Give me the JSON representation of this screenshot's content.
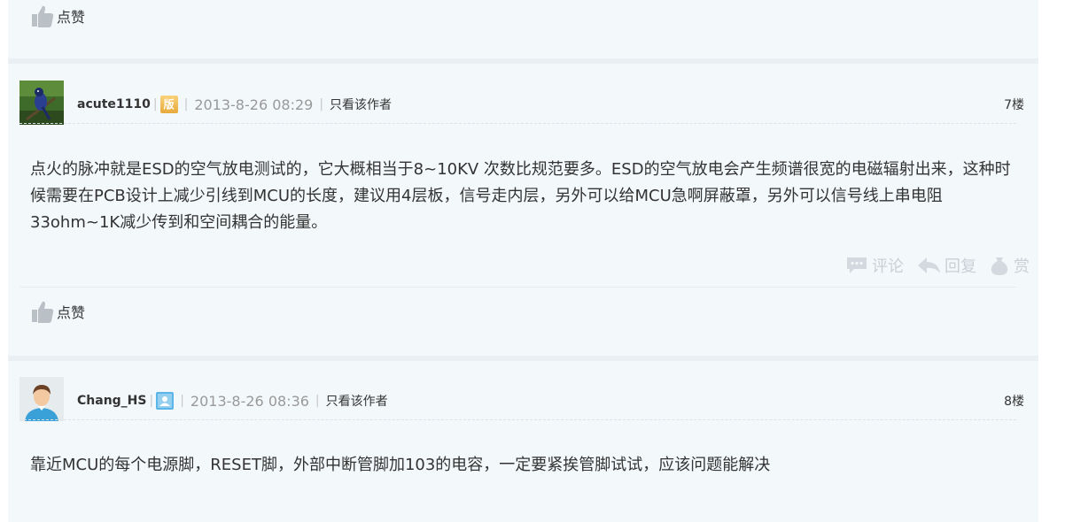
{
  "posts": [
    {
      "like_label": "点赞"
    },
    {
      "username": "acute1110",
      "badge": "版",
      "date": "2013-8-26 08:29",
      "only_author": "只看该作者",
      "floor": "7楼",
      "content": "点火的脉冲就是ESD的空气放电测试的，它大概相当于8~10KV 次数比规范要多。ESD的空气放电会产生频谱很宽的电磁辐射出来，这种时候需要在PCB设计上减少引线到MCU的长度，建议用4层板，信号走内层，另外可以给MCU急啊屏蔽罩，另外可以信号线上串电阻33ohm~1K减少传到和空间耦合的能量。",
      "actions": {
        "comment": "评论",
        "reply": "回复",
        "reward": "赏"
      },
      "like_label": "点赞"
    },
    {
      "username": "Chang_HS",
      "date": "2013-8-26 08:36",
      "only_author": "只看该作者",
      "floor": "8楼",
      "content": "靠近MCU的每个电源脚，RESET脚，外部中断管脚加103的电容，一定要紧挨管脚试试，应该问题能解决"
    }
  ],
  "colors": {
    "panel_bg": "#f3f8fb",
    "muted": "#999999",
    "icon_gray": "#c9d0d5"
  }
}
